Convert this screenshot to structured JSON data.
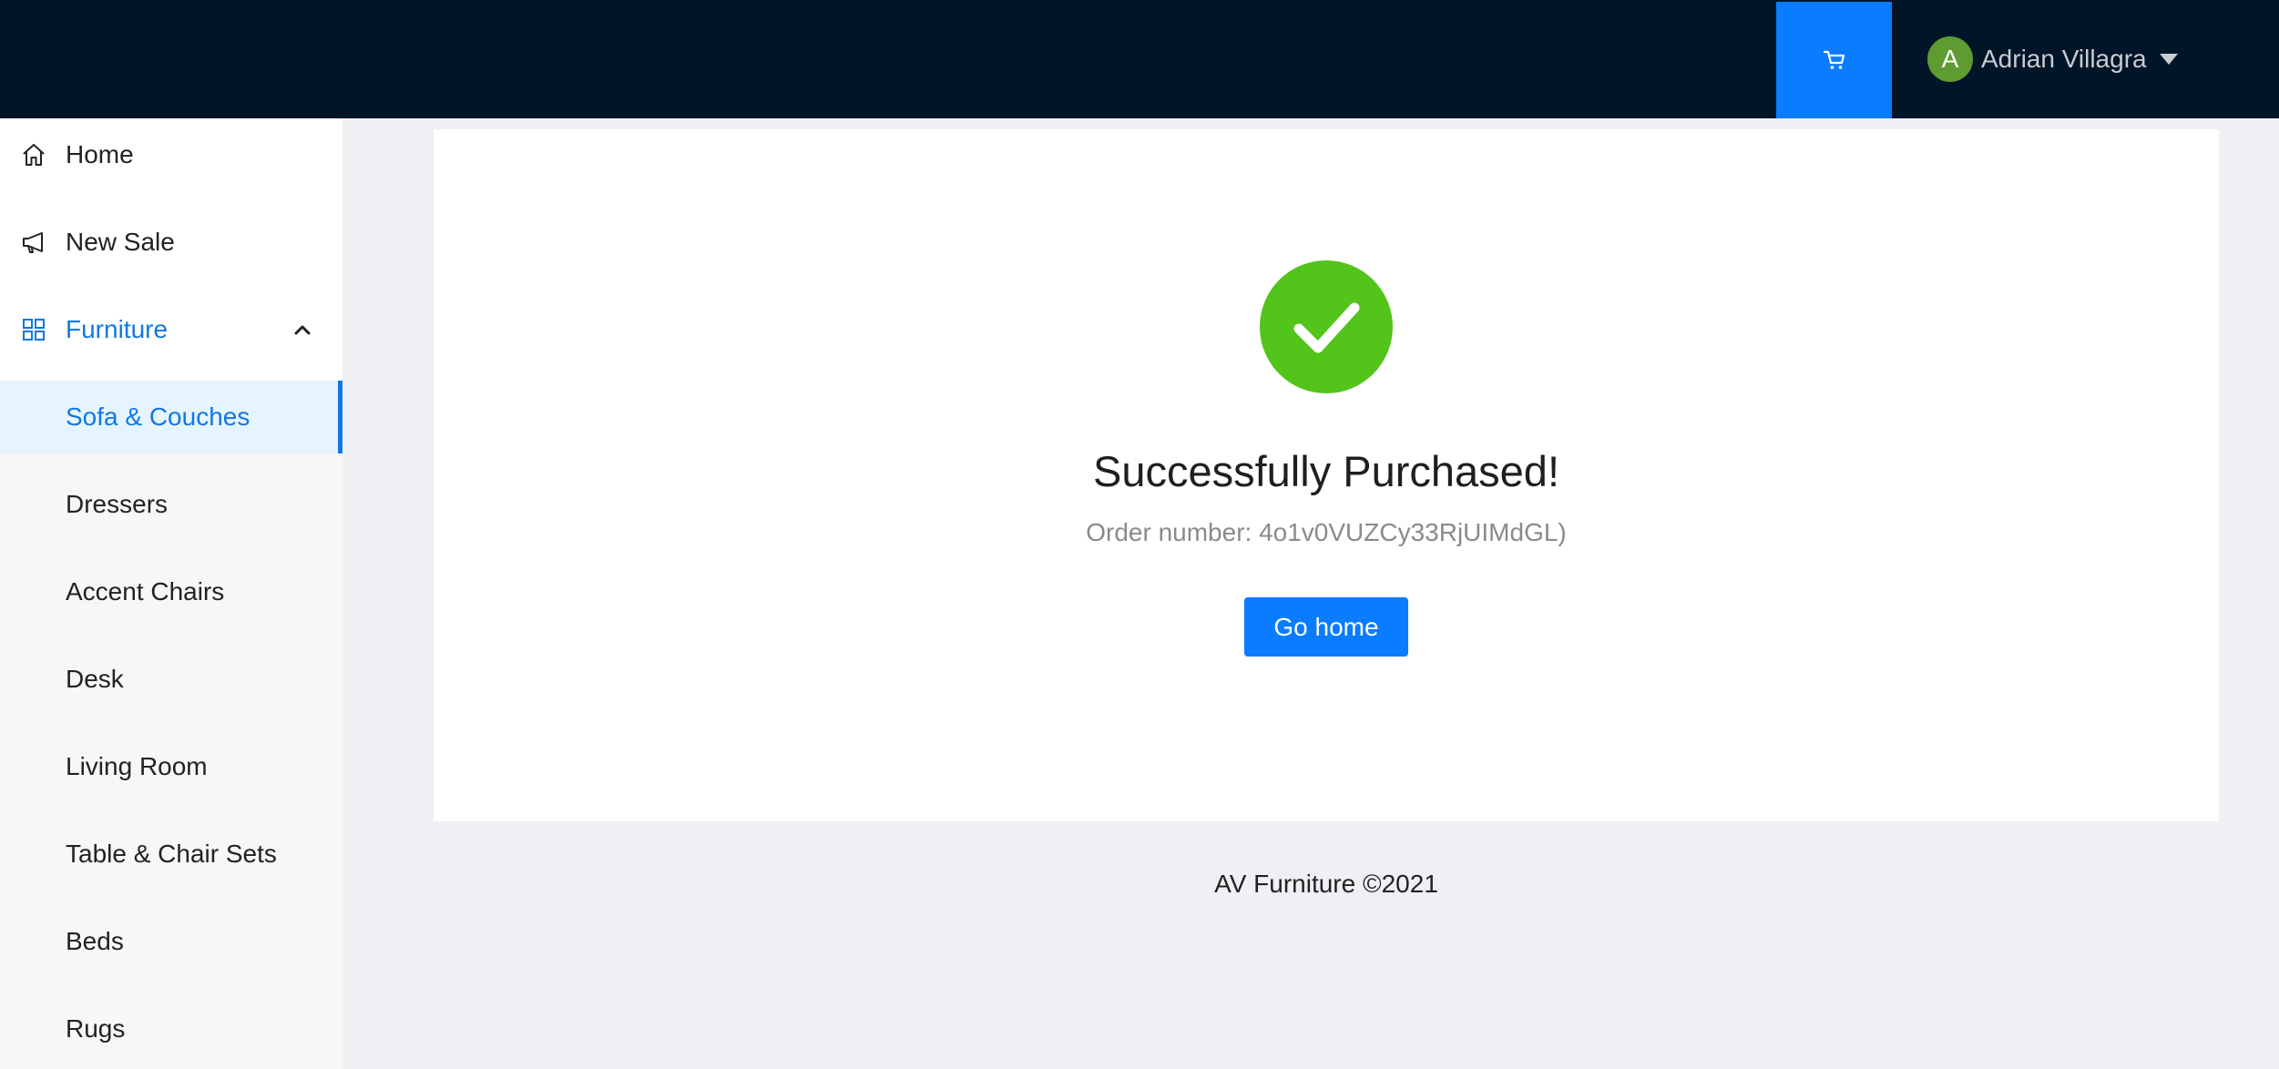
{
  "header": {
    "cart_icon": "shopping-cart-icon",
    "user": {
      "avatar_initial": "A",
      "name": "Adrian Villagra",
      "avatar_color": "#5e9c31"
    },
    "background_color": "#001528",
    "cart_button_color": "#0a7cff"
  },
  "sidebar": {
    "items": [
      {
        "label": "Home",
        "icon": "home-icon"
      },
      {
        "label": "New Sale",
        "icon": "megaphone-icon"
      },
      {
        "label": "Furniture",
        "icon": "grid-icon",
        "expanded": true
      }
    ],
    "submenu": [
      {
        "label": "Sofa & Couches",
        "selected": true
      },
      {
        "label": "Dressers"
      },
      {
        "label": "Accent Chairs"
      },
      {
        "label": "Desk"
      },
      {
        "label": "Living Room"
      },
      {
        "label": "Table & Chair Sets"
      },
      {
        "label": "Beds"
      },
      {
        "label": "Rugs"
      }
    ],
    "accent_color": "#1178e3"
  },
  "result": {
    "icon": "check-circle-icon",
    "icon_color": "#52c41a",
    "title": "Successfully Purchased!",
    "subtitle": "Order number: 4o1v0VUZCy33RjUIMdGL)",
    "button_label": "Go home"
  },
  "footer": {
    "text": "AV Furniture ©2021"
  }
}
